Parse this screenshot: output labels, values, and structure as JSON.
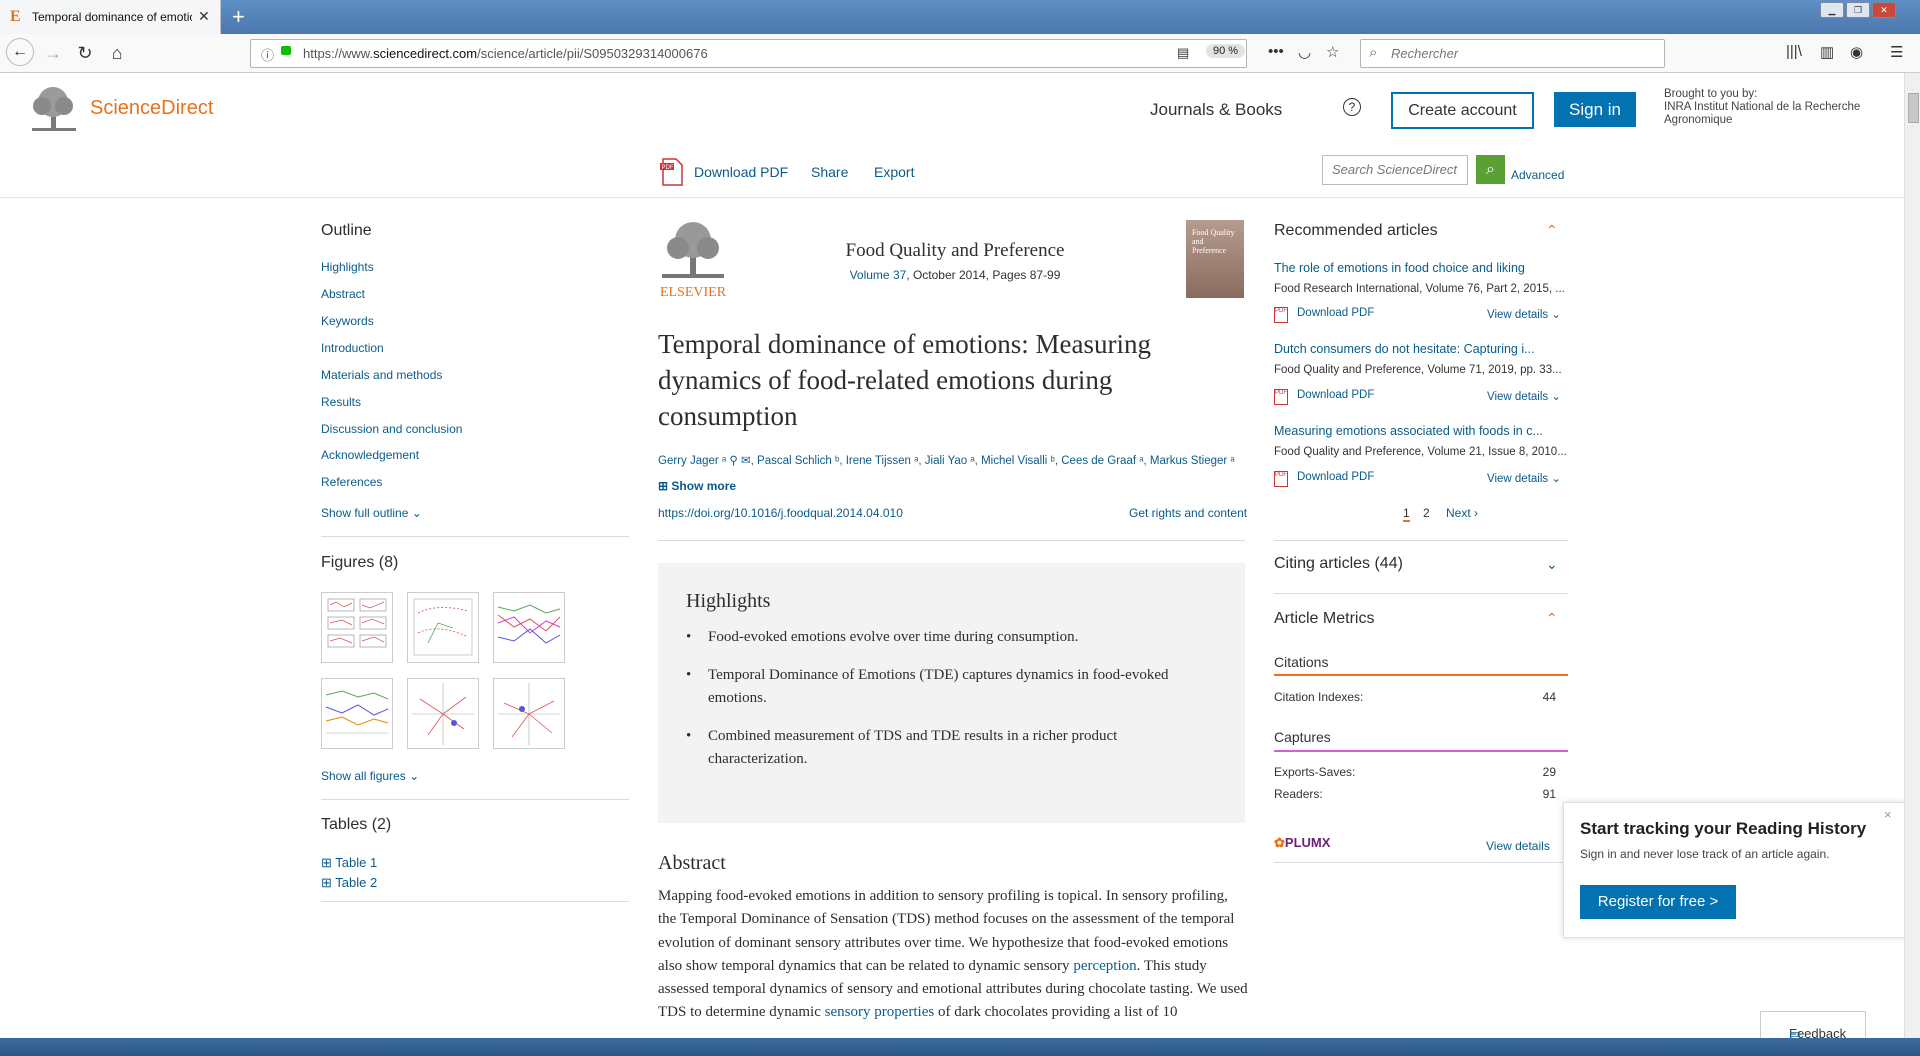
{
  "browser": {
    "tab_title": "Temporal dominance of emotions",
    "tab_favicon": "E",
    "url_prefix": "https://www.",
    "url_domain": "sciencedirect.com",
    "url_rest": "/science/article/pii/S0950329314000676",
    "zoom": "90 %",
    "search_placeholder": "Rechercher"
  },
  "header": {
    "brand": "ScienceDirect",
    "journals_books": "Journals & Books",
    "help": "?",
    "create_account": "Create account",
    "sign_in": "Sign in",
    "brought_label": "Brought to you by:",
    "brought_org": "INRA Institut National de la Recherche Agronomique"
  },
  "toolbar": {
    "download_pdf": "Download PDF",
    "share": "Share",
    "export": "Export",
    "search_placeholder": "Search ScienceDirect",
    "advanced": "Advanced"
  },
  "outline": {
    "title": "Outline",
    "items": [
      "Highlights",
      "Abstract",
      "Keywords",
      "Introduction",
      "Materials and methods",
      "Results",
      "Discussion and conclusion",
      "Acknowledgement",
      "References"
    ],
    "show_full": "Show full outline",
    "figures_title": "Figures (8)",
    "show_all_figures": "Show all figures",
    "tables_title": "Tables (2)",
    "tables": [
      "Table 1",
      "Table 2"
    ]
  },
  "article": {
    "publisher": "ELSEVIER",
    "journal": "Food Quality and Preference",
    "volume_link": "Volume 37",
    "volume_rest": ", October 2014, Pages 87-99",
    "cover_text": "Food Quality and Preference",
    "title": "Temporal dominance of emotions: Measuring dynamics of food-related emotions during consumption",
    "authors": "Gerry Jager ᵃ ⚲ ✉, Pascal Schlich ᵇ, Irene Tijssen ᵃ, Jiali Yao ᵃ, Michel Visalli ᵇ, Cees de Graaf ᵃ, Markus Stieger ᵃ",
    "show_more": "Show more",
    "doi": "https://doi.org/10.1016/j.foodqual.2014.04.010",
    "rights": "Get rights and content",
    "highlights_title": "Highlights",
    "highlights": [
      "Food-evoked emotions evolve over time during consumption.",
      "Temporal Dominance of Emotions (TDE) captures dynamics in food-evoked emotions.",
      "Combined measurement of TDS and TDE results in a richer product characterization."
    ],
    "abstract_title": "Abstract",
    "abstract_1": "Mapping food-evoked emotions in addition to sensory profiling is topical. In sensory profiling, the Temporal Dominance of Sensation (TDS) method focuses on the assessment of the temporal evolution of dominant sensory attributes over time. We hypothesize that food-evoked emotions also show temporal dynamics that can be related to dynamic sensory ",
    "abstract_link1": "perception",
    "abstract_2": ". This study assessed temporal dynamics of sensory and emotional attributes during chocolate tasting. We used TDS to determine dynamic ",
    "abstract_link2": "sensory properties",
    "abstract_3": " of dark chocolates providing a list of 10"
  },
  "recommended": {
    "title": "Recommended articles",
    "items": [
      {
        "title": "The role of emotions in food choice and liking",
        "meta": "Food Research International, Volume 76, Part 2, 2015, ...",
        "pdf": "Download PDF",
        "view": "View details"
      },
      {
        "title": "Dutch consumers do not hesitate: Capturing i...",
        "meta": "Food Quality and Preference, Volume 71, 2019, pp. 33...",
        "pdf": "Download PDF",
        "view": "View details"
      },
      {
        "title": "Measuring emotions associated with foods in c...",
        "meta": "Food Quality and Preference, Volume 21, Issue 8, 2010...",
        "pdf": "Download PDF",
        "view": "View details"
      }
    ],
    "page1": "1",
    "page2": "2",
    "next": "Next"
  },
  "citing": {
    "title": "Citing articles (44)"
  },
  "metrics": {
    "title": "Article Metrics",
    "citations_title": "Citations",
    "citation_indexes_label": "Citation Indexes:",
    "citation_indexes_value": "44",
    "captures_title": "Captures",
    "exports_label": "Exports-Saves:",
    "exports_value": "29",
    "readers_label": "Readers:",
    "readers_value": "91",
    "plumx": "PLUMX",
    "view_details": "View details",
    "citations_color": "#e9711c",
    "captures_color": "#d15fd8"
  },
  "popup": {
    "heading": "Start tracking your Reading History",
    "sub": "Sign in and never lose track of an article again.",
    "button": "Register for free >",
    "close": "×"
  },
  "feedback": {
    "label": "Feedback"
  },
  "colors": {
    "brand": "#e9711c",
    "link": "#0b5b8a",
    "primary": "#0272b1"
  }
}
